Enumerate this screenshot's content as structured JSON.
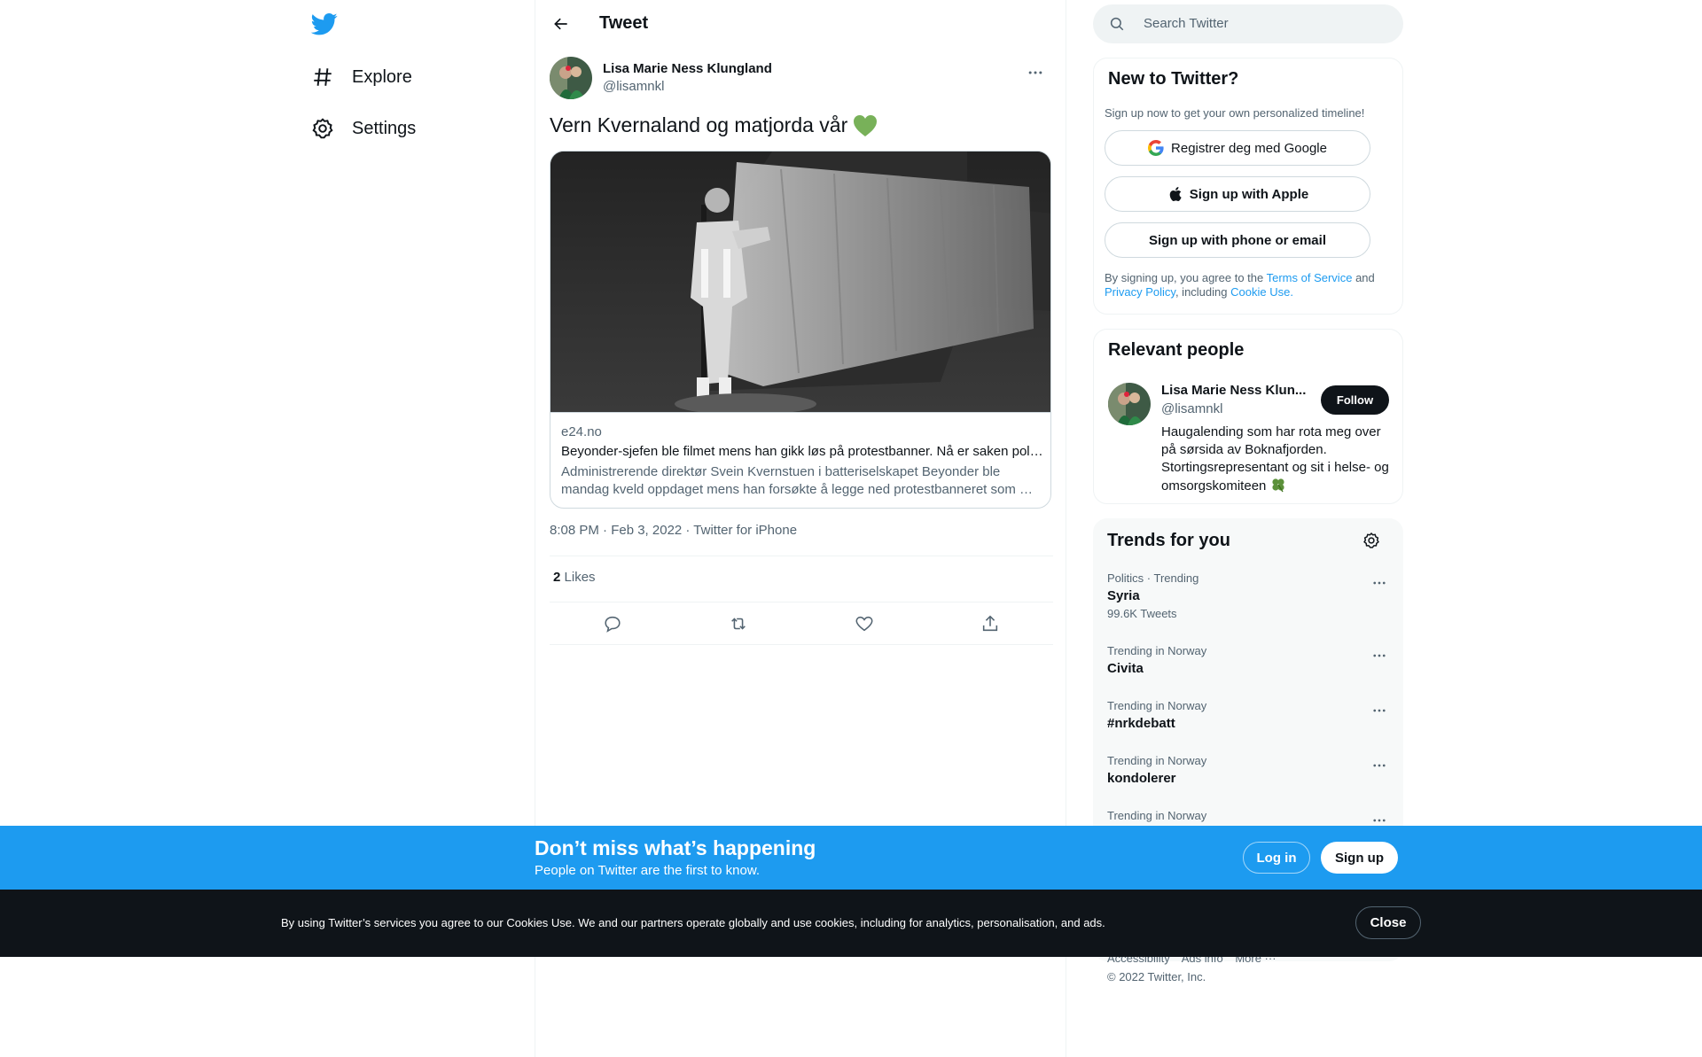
{
  "nav": {
    "explore": "Explore",
    "settings": "Settings"
  },
  "header": {
    "title": "Tweet"
  },
  "tweet": {
    "author_name": "Lisa Marie Ness Klungland",
    "author_handle": "@lisamnkl",
    "text": "Vern Kvernaland og matjorda vår",
    "emoji": "green-heart",
    "card": {
      "domain": "e24.no",
      "title": "Beyonder-sjefen ble filmet mens han gikk løs på protestbanner. Nå er saken politianmeldt.",
      "description": "Administrerende direktør Svein Kvernstuen i batteriselskapet Beyonder ble mandag kveld oppdaget mens han forsøkte å legge ned protestbanneret som …"
    },
    "meta": "8:08 PM · Feb 3, 2022 · Twitter for iPhone",
    "likes_count": "2",
    "likes_label": "Likes"
  },
  "search": {
    "placeholder": "Search Twitter"
  },
  "signup_panel": {
    "title": "New to Twitter?",
    "subtitle": "Sign up now to get your own personalized timeline!",
    "google": "Registrer deg med Google",
    "apple": "Sign up with Apple",
    "phone": "Sign up with phone or email",
    "legal_prefix": "By signing up, you agree to the",
    "terms": "Terms of Service",
    "and": "and",
    "privacy": "Privacy Policy",
    "including": ", including",
    "cookie": "Cookie Use."
  },
  "relevant": {
    "title": "Relevant people",
    "name": "Lisa Marie Ness Klun...",
    "handle": "@lisamnkl",
    "follow": "Follow",
    "bio": "Haugalending som har rota meg over på sørsida av Boknafjorden. Stortingsrepresentant og sit i helse- og omsorgskomiteen"
  },
  "trends": {
    "title": "Trends for you",
    "items": [
      {
        "context": "Politics · Trending",
        "name": "Syria",
        "count": "99.6K Tweets"
      },
      {
        "context": "Trending in Norway",
        "name": "Civita",
        "count": ""
      },
      {
        "context": "Trending in Norway",
        "name": "#nrkdebatt",
        "count": ""
      },
      {
        "context": "Trending in Norway",
        "name": "kondolerer",
        "count": ""
      },
      {
        "context": "Trending in Norway",
        "name": "",
        "count": ""
      }
    ]
  },
  "footer": {
    "accessibility": "Accessibility",
    "ads": "Ads info",
    "more": "More ···",
    "copyright": "© 2022 Twitter, Inc."
  },
  "banner": {
    "title": "Don’t miss what’s happening",
    "subtitle": "People on Twitter are the first to know.",
    "login": "Log in",
    "signup": "Sign up"
  },
  "cookie": {
    "text": "By using Twitter’s services you agree to our Cookies Use. We and our partners operate globally and use cookies, including for analytics, personalisation, and ads.",
    "close": "Close"
  },
  "colors": {
    "brand": "#1d9bf0",
    "text": "#0f1419",
    "muted": "#536471"
  }
}
